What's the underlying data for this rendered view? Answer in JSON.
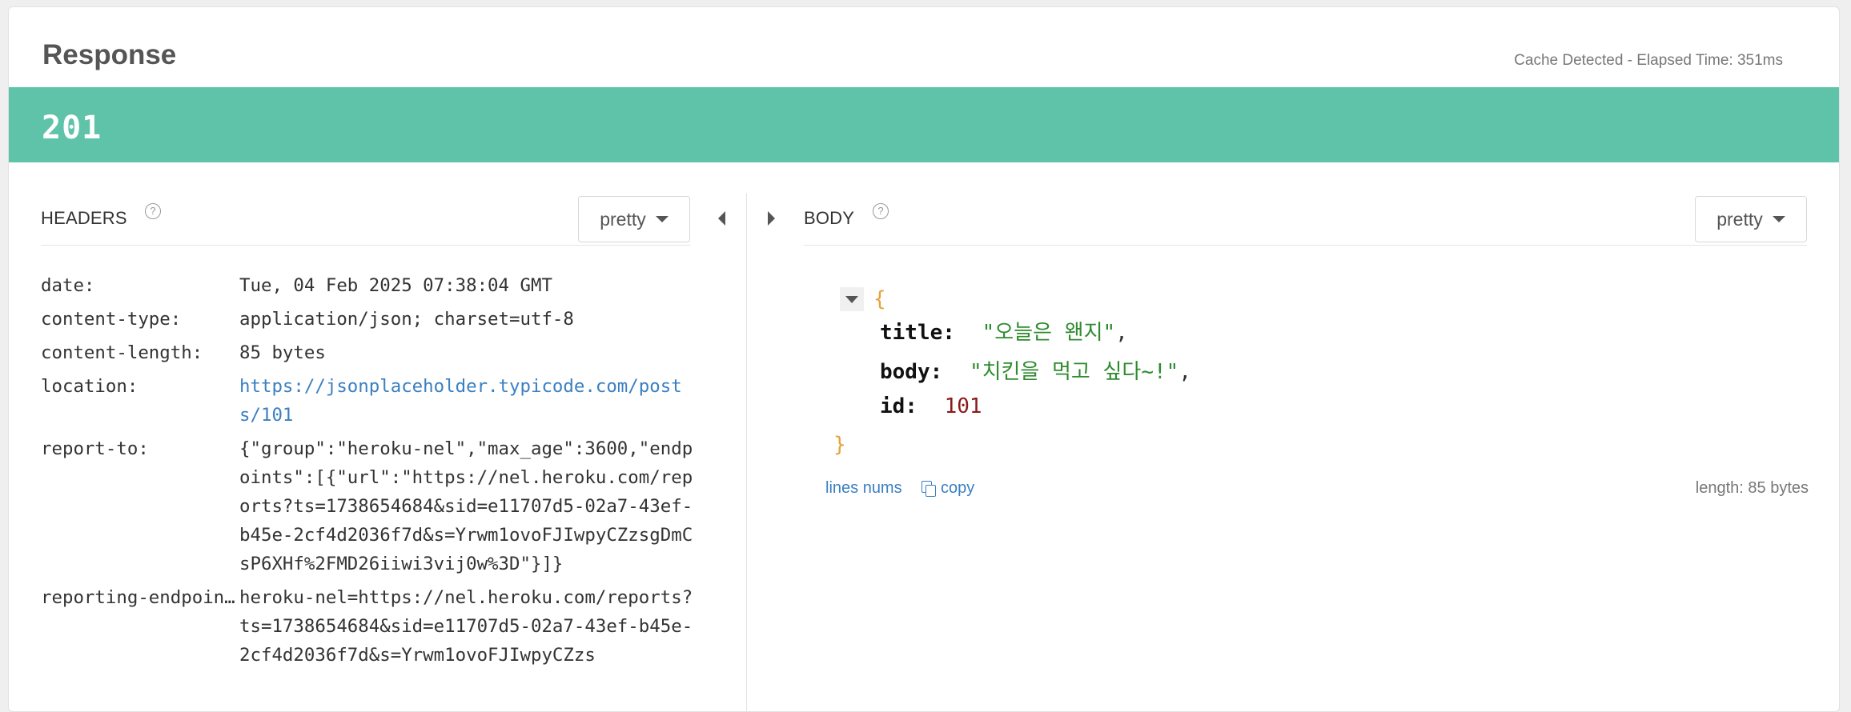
{
  "panel": {
    "title": "Response",
    "meta": "Cache Detected - Elapsed Time: 351ms",
    "status_code": "201",
    "status_color": "#5ec3a8"
  },
  "headers_section": {
    "title": "HEADERS",
    "help_symbol": "?",
    "format_label": "pretty",
    "rows": [
      {
        "key": "date:",
        "value": "Tue, 04 Feb 2025 07:38:04 GMT"
      },
      {
        "key": "content-type:",
        "value": "application/json; charset=utf-8"
      },
      {
        "key": "content-length:",
        "value": "85 bytes"
      },
      {
        "key": "location:",
        "value": "https://jsonplaceholder.typicode.com/posts/101",
        "is_link": true
      },
      {
        "key": "report-to:",
        "value": "{\"group\":\"heroku-nel\",\"max_age\":3600,\"endpoints\":[{\"url\":\"https://nel.heroku.com/reports?ts=1738654684&sid=e11707d5-02a7-43ef-b45e-2cf4d2036f7d&s=Yrwm1ovoFJIwpyCZzsgDmCsP6XHf%2FMD26iiwi3vij0w%3D\"}]}"
      },
      {
        "key": "reporting-endpoints:",
        "value": "heroku-nel=https://nel.heroku.com/reports?ts=1738654684&sid=e11707d5-02a7-43ef-b45e-2cf4d2036f7d&s=Yrwm1ovoFJIwpyCZzs"
      }
    ]
  },
  "body_section": {
    "title": "BODY",
    "help_symbol": "?",
    "format_label": "pretty",
    "json": {
      "open_brace": "{",
      "close_brace": "}",
      "fields": [
        {
          "key": "title:",
          "value": "\"오늘은 왠지\"",
          "type": "string",
          "comma": ","
        },
        {
          "key": "body:",
          "value": "\"치킨을 먹고 싶다~!\"",
          "type": "string",
          "comma": ","
        },
        {
          "key": "id:",
          "value": "101",
          "type": "number",
          "comma": ""
        }
      ]
    },
    "lines_nums_label": "lines nums",
    "copy_label": "copy",
    "length_label": "length: 85 bytes"
  }
}
